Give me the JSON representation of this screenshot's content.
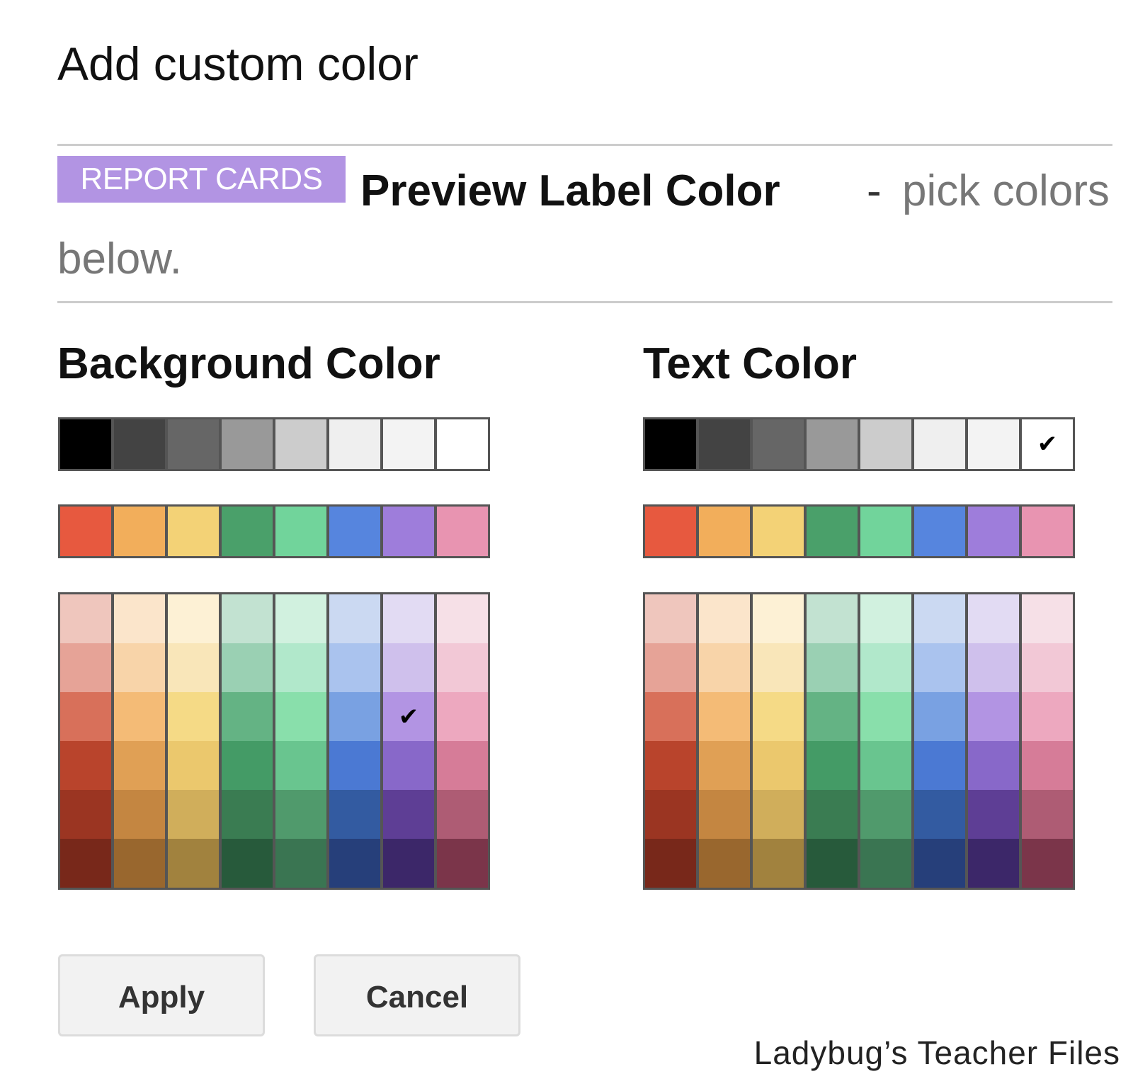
{
  "dialog": {
    "title": "Add custom color",
    "preview": {
      "label_text": "REPORT CARDS",
      "label_bg_color": "#b294e3",
      "label_text_color": "#ffffff",
      "title": "Preview Label Color",
      "separator": "-",
      "hint_part1": "pick colors",
      "hint_part2": "below."
    },
    "background_color": {
      "title": "Background Color",
      "selected": "#b294e3"
    },
    "text_color": {
      "title": "Text Color",
      "selected": "#ffffff"
    },
    "buttons": {
      "apply": "Apply",
      "cancel": "Cancel"
    }
  },
  "palette": {
    "grays": [
      "#000000",
      "#434343",
      "#666666",
      "#999999",
      "#cccccc",
      "#efefef",
      "#f3f3f3",
      "#ffffff"
    ],
    "brights": [
      "#e7593f",
      "#f2ae5b",
      "#f3d276",
      "#4aa06a",
      "#71d49b",
      "#5685de",
      "#9e7ddb",
      "#e894b1"
    ],
    "shades": [
      [
        "#efc6bd",
        "#fbe5cb",
        "#fdf1d5",
        "#c2e2d1",
        "#d1f1df",
        "#cbd9f2",
        "#e2dbf3",
        "#f6e0e7"
      ],
      [
        "#e6a397",
        "#f8d4a9",
        "#f9e6b9",
        "#9ad0b3",
        "#b1e8cb",
        "#aac3ee",
        "#cfc0ec",
        "#f2c8d6"
      ],
      [
        "#d8705a",
        "#f4bb76",
        "#f5da86",
        "#64b384",
        "#89dfab",
        "#79a1e2",
        "#b294e3",
        "#eda8bf"
      ],
      [
        "#b9442c",
        "#e0a055",
        "#ebc86d",
        "#449b66",
        "#69c58f",
        "#4b79d3",
        "#8868c9",
        "#d67c98"
      ],
      [
        "#9b3522",
        "#c48641",
        "#d0ae5b",
        "#3a7c52",
        "#509a6c",
        "#335ba1",
        "#5e3e95",
        "#ae5c74"
      ],
      [
        "#78281a",
        "#99672e",
        "#a1823e",
        "#275a3b",
        "#3a7552",
        "#263f7a",
        "#3c2769",
        "#7b354a"
      ]
    ]
  },
  "watermark": "Ladybug’s Teacher Files"
}
